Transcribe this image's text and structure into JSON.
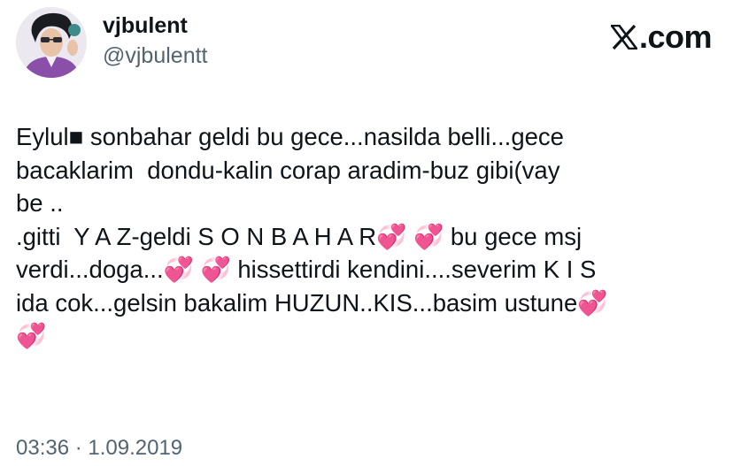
{
  "author": {
    "display_name": "vjbulent",
    "handle": "@vjbulentt"
  },
  "brand": {
    "icon": "x-logo-icon",
    "label": ".com"
  },
  "tweet": {
    "text": "Eylul■ sonbahar geldi bu gece...nasilda belli...gece\nbacaklarim  dondu-kalin corap aradim-buz gibi(vay\nbe ..\n.gitti  Y A Z-geldi S O N B A H A R💞 💞 bu gece msj\nverdi...doga...💞 💞 hissettirdi kendini....severim K I S\nida cok...gelsin bakalim HUZUN..KIS...basim ustune💞\n💞",
    "timestamp": "03:36 · 1.09.2019"
  },
  "colors": {
    "text_primary": "#0f1419",
    "text_secondary": "#536471",
    "background": "#ffffff"
  }
}
